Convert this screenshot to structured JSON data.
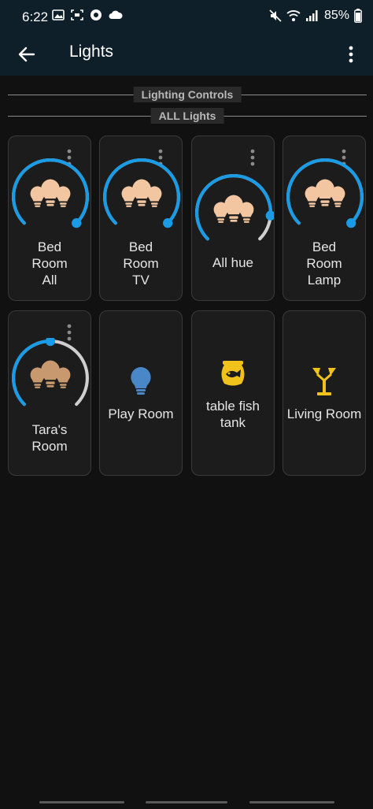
{
  "status": {
    "time": "6:22",
    "battery": "85%"
  },
  "appbar": {
    "title": "Lights"
  },
  "sections": {
    "controls": "Lighting Controls",
    "all": "ALL Lights"
  },
  "tiles": [
    {
      "name_lines": [
        "Bed",
        "Room",
        "All"
      ],
      "brightness": 1.0
    },
    {
      "name_lines": [
        "Bed",
        "Room",
        "TV"
      ],
      "brightness": 1.0
    },
    {
      "name_lines": [
        "All hue"
      ],
      "brightness": 0.85
    },
    {
      "name_lines": [
        "Bed",
        "Room",
        "Lamp"
      ],
      "brightness": 1.0
    },
    {
      "name_lines": [
        "Tara's",
        "Room"
      ],
      "brightness": 0.5
    },
    {
      "name_lines": [
        "Play Room"
      ]
    },
    {
      "name_lines": [
        "table fish",
        "tank"
      ]
    },
    {
      "name_lines": [
        "Living Room"
      ]
    }
  ],
  "colors": {
    "accent": "#1a9be6",
    "track": "#cfcfcf",
    "bulb_warm": "#f2c6a0",
    "bulb_dim": "#c8996f",
    "bulb_blue": "#4a87c9",
    "icon_yellow": "#f2c21c"
  },
  "icons": [
    "back-arrow-icon",
    "overflow-menu-icon",
    "bulb-group-icon",
    "bulb-icon",
    "fish-tank-icon",
    "lamp-icon"
  ]
}
